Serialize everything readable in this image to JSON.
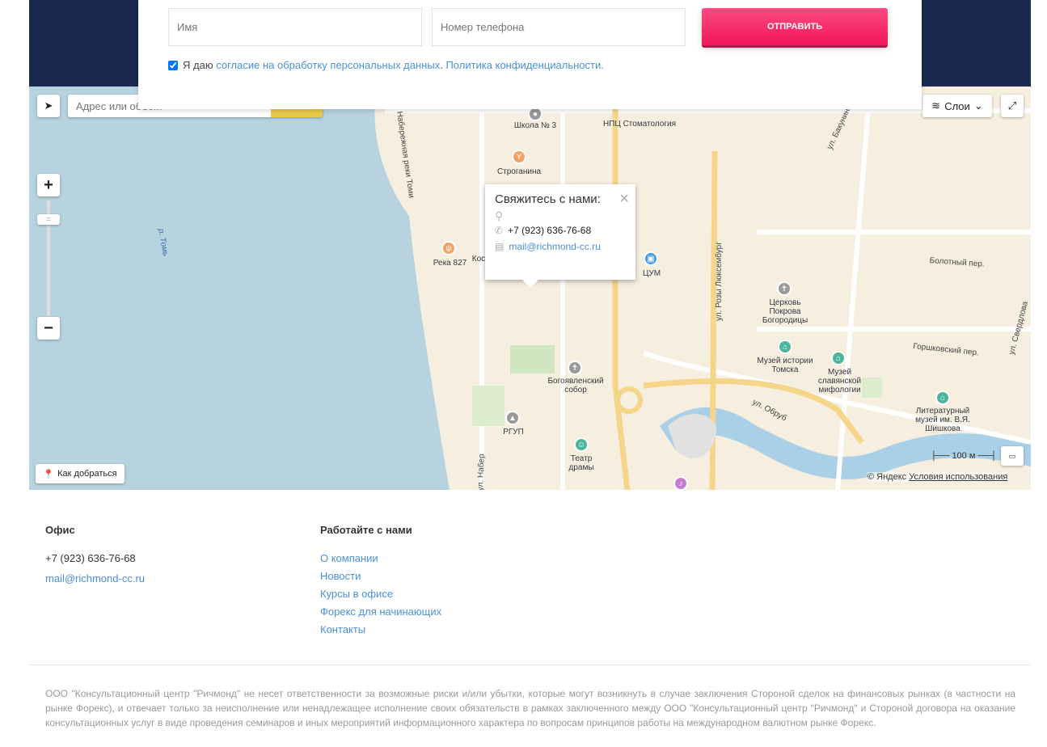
{
  "form": {
    "name_placeholder": "Имя",
    "phone_placeholder": "Номер телефона",
    "submit_label": "ОТПРАВИТЬ",
    "consent_prefix": "Я даю",
    "consent_link": "согласие на обработку персональных данных",
    "consent_sep": ".",
    "privacy_link": "Политика конфиденциальности."
  },
  "map": {
    "search_placeholder": "Адрес или объект",
    "layers_label": "Слои",
    "route_label": "Как добраться",
    "scale_label": "100 м",
    "copyright": "© Яндекс",
    "terms_link": "Условия использования",
    "balloon": {
      "title": "Свяжитесь с нами:",
      "phone": "+7 (923) 636-76-68",
      "email": "mail@richmond-cc.ru"
    },
    "places": [
      "Школа № 3",
      "НПЦ Стоматология",
      "Строганина",
      "Река 827",
      "Кос",
      "ЦУМ",
      "Церковь Покрова Богородицы",
      "Музей истории Томска",
      "Музей славянской мифологии",
      "Литературный музей им. В.Я. Шишкова",
      "Богоявленский собор",
      "РГУП",
      "Театр драмы"
    ],
    "streets": [
      "р. Томь",
      "Набережная реки Томи",
      "ул. Розы Люксембург",
      "Болотный пер.",
      "Горшковский пер.",
      "ул. Обруб",
      "ул. Бакунина",
      "ул. Свердлова",
      "ул. Набер"
    ]
  },
  "colors": {
    "accent": "#f2155a",
    "navy": "#1b2850",
    "link": "#4a90d9"
  },
  "footer": {
    "office_title": "Офис",
    "phone": "+7 (923) 636-76-68",
    "email": "mail@richmond-cc.ru",
    "work_title": "Работайте с нами",
    "links": [
      "О компании",
      "Новости",
      "Курсы в офисе",
      "Форекс для начинающих",
      "Контакты"
    ],
    "disclaimer": "ООО \"Консультационный центр \"Ричмонд\" не несет ответственности за возможные риски и/или убытки, которые могут возникнуть в случае заключения Стороной сделок на финансовых рынках (в частности на рынке Форекс), и отвечает только за неисполнение или ненадлежащее исполнение своих обязательств в рамках заключенного между ООО \"Консультационный центр \"Ричмонд\" и Стороной договора на оказание консультационных услуг в виде проведения семинаров и иных мероприятий информационного характера по вопросам принципов работы на международном валютном рынке Форекс."
  }
}
